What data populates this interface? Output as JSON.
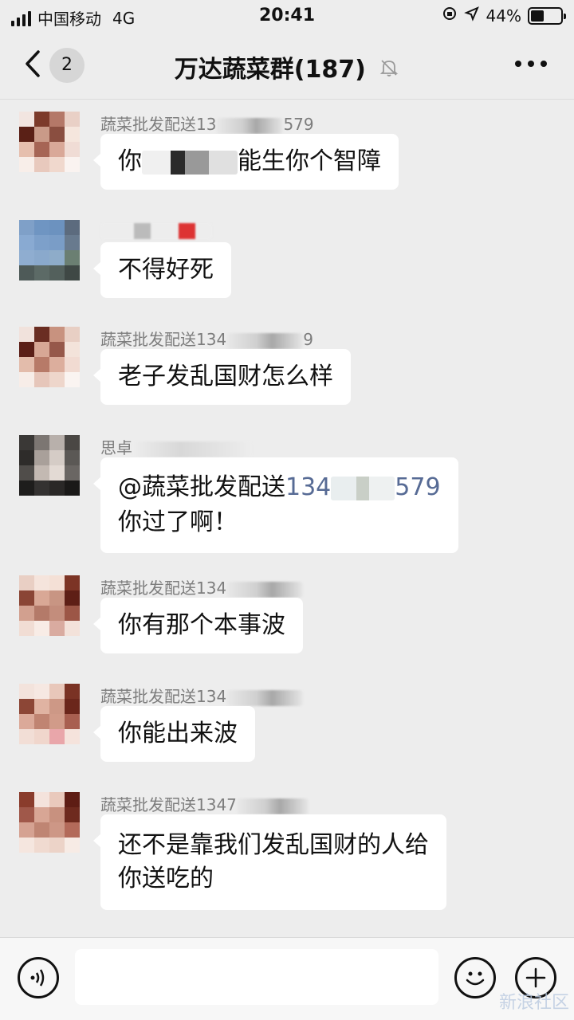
{
  "status_bar": {
    "carrier": "中国移动",
    "network": "4G",
    "time": "20:41",
    "battery_percent": "44%",
    "battery_level": 0.44
  },
  "nav": {
    "unread_count": "2",
    "title": "万达蔬菜群(187)"
  },
  "messages": [
    {
      "sender_prefix": "蔬菜批发配送13",
      "sender_suffix": "579",
      "text_before": "你",
      "text_after": "能生你个智障"
    },
    {
      "sender_prefix": "",
      "sender_suffix": "",
      "text": "不得好死"
    },
    {
      "sender_prefix": "蔬菜批发配送134",
      "sender_suffix": "9",
      "text": "老子发乱国财怎么样"
    },
    {
      "sender_prefix": "思卓",
      "sender_suffix": "",
      "mention_prefix": "@蔬菜批发配送",
      "mention_num_start": "134",
      "mention_num_end": "579",
      "line2": "你过了啊！"
    },
    {
      "sender_prefix": "蔬菜批发配送134",
      "sender_suffix": "",
      "text": "你有那个本事波"
    },
    {
      "sender_prefix": "蔬菜批发配送134",
      "sender_suffix": "",
      "text": "你能出来波"
    },
    {
      "sender_prefix": "蔬菜批发配送1347",
      "sender_suffix": "",
      "line1": "还不是靠我们发乱国财的人给",
      "line2": "你送吃的"
    }
  ],
  "input": {
    "placeholder": ""
  },
  "watermark": "新浪社区",
  "colors": {
    "background": "#ededed",
    "bubble": "#ffffff",
    "mention": "#576b95"
  }
}
